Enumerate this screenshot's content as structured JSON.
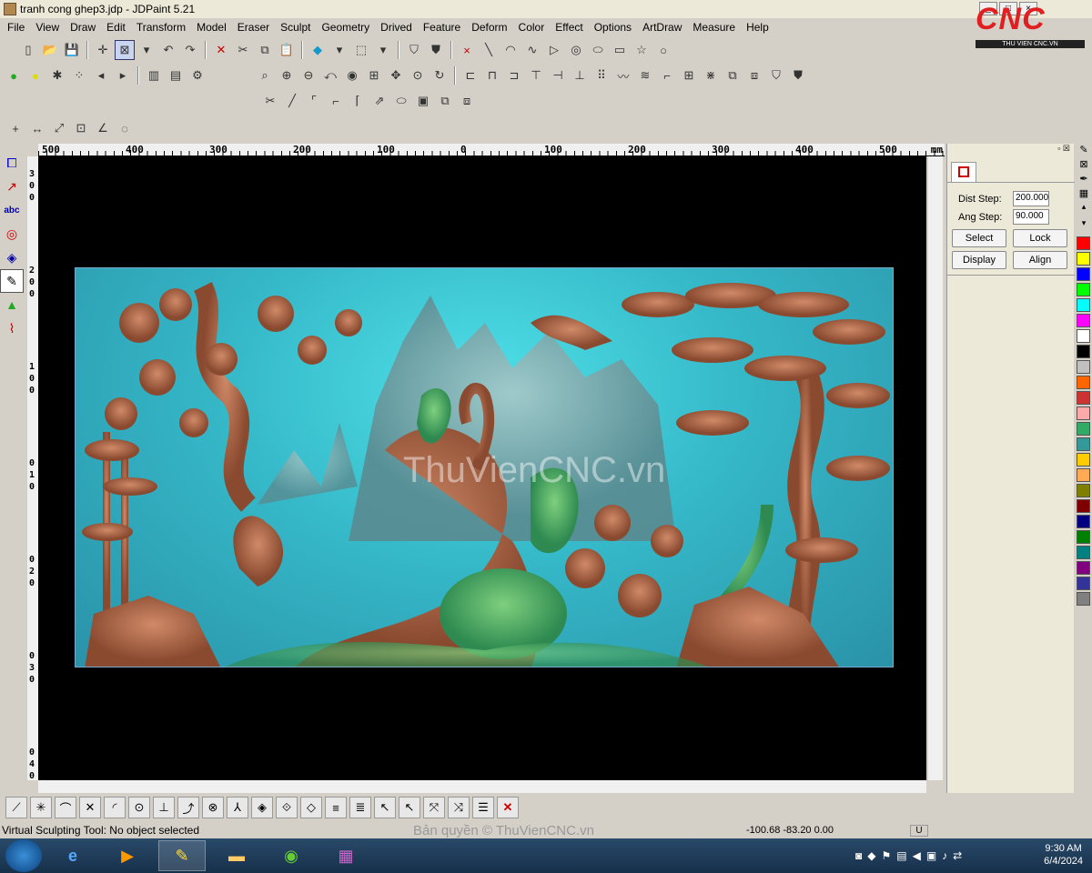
{
  "window": {
    "title": "tranh cong ghep3.jdp - JDPaint 5.21"
  },
  "logo": {
    "text": "CNC",
    "subtitle": "THU VIEN CNC.VN"
  },
  "menu": [
    "File",
    "View",
    "Draw",
    "Edit",
    "Transform",
    "Model",
    "Eraser",
    "Sculpt",
    "Geometry",
    "Drived",
    "Feature",
    "Deform",
    "Color",
    "Effect",
    "Options",
    "ArtDraw",
    "Measure",
    "Help"
  ],
  "ruler": {
    "labels": [
      "500",
      "400",
      "300",
      "200",
      "100",
      "0",
      "100",
      "200",
      "300",
      "400",
      "500"
    ],
    "unit": "mm"
  },
  "vruler": {
    "labels": [
      "3",
      "0",
      "0",
      "2",
      "0",
      "0",
      "1",
      "0",
      "0",
      "0",
      "1",
      "0",
      "0",
      "2",
      "0",
      "0",
      "3",
      "0",
      "0",
      "4",
      "0"
    ]
  },
  "canvas": {
    "watermark": "ThuVienCNC.vn"
  },
  "panel": {
    "dist_label": "Dist Step:",
    "dist_value": "200.000",
    "ang_label": "Ang Step:",
    "ang_value": "90.000",
    "btn_select": "Select",
    "btn_lock": "Lock",
    "btn_display": "Display",
    "btn_align": "Align"
  },
  "palette": [
    "#ff0000",
    "#ffff00",
    "#0000ff",
    "#00ff00",
    "#00ffff",
    "#ff00ff",
    "#ffffff",
    "#000000",
    "#c0c0c0",
    "#ff6600",
    "#cc3333",
    "#ffaaaa",
    "#33aa66",
    "#339999",
    "#ffcc00",
    "#ffaa55",
    "#808000",
    "#800000",
    "#000080",
    "#008000",
    "#008080",
    "#800080",
    "#333399",
    "#808080"
  ],
  "status": {
    "text": "Virtual Sculpting Tool: No object selected",
    "copyright": "Bản quyền © ThuVienCNC.vn",
    "coords": "-100.68 -83.20 0.00",
    "unit": "U"
  },
  "clock": {
    "time": "9:30 AM",
    "date": "6/4/2024"
  }
}
